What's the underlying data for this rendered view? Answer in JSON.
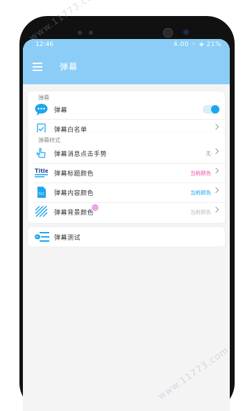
{
  "status": {
    "time": "12:46",
    "right": "4.00 ⁘ ◈ 21%"
  },
  "app": {
    "title": "弹幕",
    "menu_icon": "menu-icon"
  },
  "section1": {
    "label": "弹幕",
    "rows": [
      {
        "icon": "chat-bubble-icon",
        "label": "弹幕",
        "toggle_on": true
      },
      {
        "icon": "whitelist-icon",
        "label": "弹幕白名单"
      }
    ]
  },
  "section2": {
    "label": "弹幕样式",
    "rows": [
      {
        "icon": "hand-tap-icon",
        "label": "弹幕消息点击手势",
        "value": "无",
        "value_color": "#999999"
      },
      {
        "icon": "title-icon",
        "label": "弹幕标题颜色",
        "value": "当前颜色",
        "value_color": "#f04fa7"
      },
      {
        "icon": "text-icon",
        "label": "弹幕内容颜色",
        "value": "当前颜色",
        "value_color": "#1fa6ec"
      },
      {
        "icon": "stripes-icon",
        "label": "弹幕背景颜色",
        "value": "当前颜色",
        "value_color": "#bbbbbb"
      }
    ]
  },
  "section3": {
    "rows": [
      {
        "icon": "danmaku-test-icon",
        "label": "弹幕测试"
      }
    ]
  },
  "watermark": {
    "top": "www.11773.com",
    "bottom": "www.11773.com"
  },
  "colors": {
    "accent": "#8bcdf6",
    "toggle": "#1fa6ec",
    "pink": "#f04fa7"
  }
}
